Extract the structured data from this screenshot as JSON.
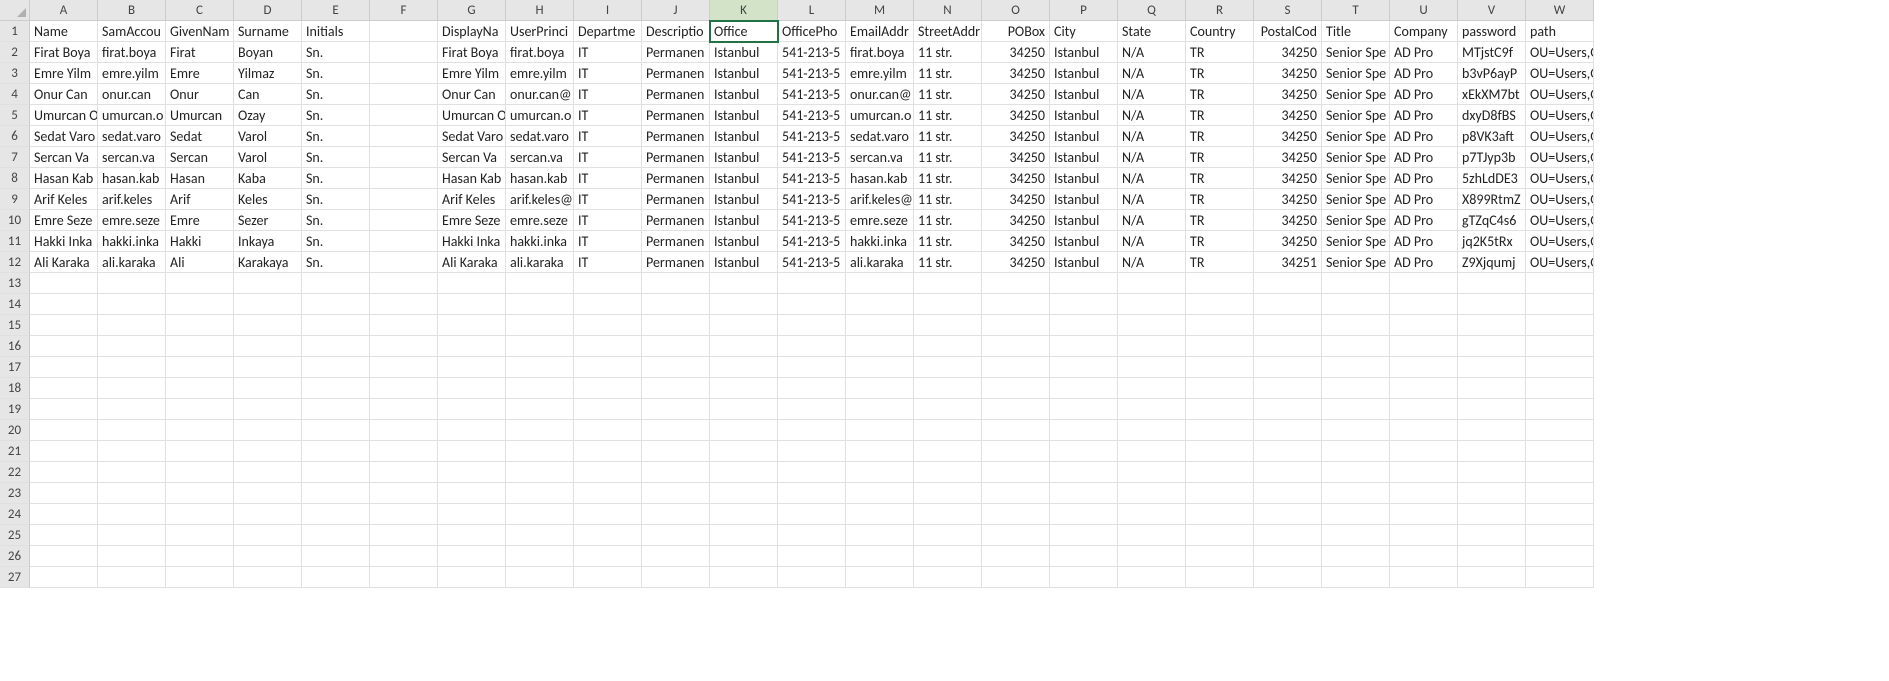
{
  "chart_data": {
    "type": "table",
    "columns": [
      "Name",
      "SamAccou",
      "GivenNam",
      "Surname",
      "Initials",
      "",
      "DisplayNa",
      "UserPrinci",
      "Departme",
      "Descriptio",
      "Office",
      "OfficePho",
      "EmailAddr",
      "StreetAddr",
      "POBox",
      "City",
      "State",
      "Country",
      "PostalCod",
      "Title",
      "Company",
      "password",
      "path"
    ],
    "rows": [
      [
        "Firat Boya",
        "firat.boya",
        "Firat",
        "Boyan",
        "Sn.",
        "",
        "Firat Boya",
        "firat.boya",
        "IT",
        "Permanen",
        "Istanbul",
        "541-213-5",
        "firat.boya",
        "11 str.",
        "34250",
        "Istanbul",
        "N/A",
        "TR",
        "34250",
        "Senior Spe",
        "AD Pro",
        "MTjstC9f",
        "OU=Users,OU=IT,OU=Is"
      ],
      [
        "Emre Yilm",
        "emre.yilm",
        "Emre",
        "Yilmaz",
        "Sn.",
        "",
        "Emre Yilm",
        "emre.yilm",
        "IT",
        "Permanen",
        "Istanbul",
        "541-213-5",
        "emre.yilm",
        "11 str.",
        "34250",
        "Istanbul",
        "N/A",
        "TR",
        "34250",
        "Senior Spe",
        "AD Pro",
        "b3vP6ayP",
        "OU=Users,OU=IT,OU=Is"
      ],
      [
        "Onur Can",
        "onur.can",
        "Onur",
        "Can",
        "Sn.",
        "",
        "Onur Can",
        "onur.can@",
        "IT",
        "Permanen",
        "Istanbul",
        "541-213-5",
        "onur.can@",
        "11 str.",
        "34250",
        "Istanbul",
        "N/A",
        "TR",
        "34250",
        "Senior Spe",
        "AD Pro",
        "xEkXM7bt",
        "OU=Users,OU=IT,OU=Is"
      ],
      [
        "Umurcan O",
        "umurcan.o",
        "Umurcan",
        "Ozay",
        "Sn.",
        "",
        "Umurcan O",
        "umurcan.o",
        "IT",
        "Permanen",
        "Istanbul",
        "541-213-5",
        "umurcan.o",
        "11 str.",
        "34250",
        "Istanbul",
        "N/A",
        "TR",
        "34250",
        "Senior Spe",
        "AD Pro",
        "dxyD8fBS",
        "OU=Users,OU=IT,OU=Is"
      ],
      [
        "Sedat Varo",
        "sedat.varo",
        "Sedat",
        "Varol",
        "Sn.",
        "",
        "Sedat Varo",
        "sedat.varo",
        "IT",
        "Permanen",
        "Istanbul",
        "541-213-5",
        "sedat.varo",
        "11 str.",
        "34250",
        "Istanbul",
        "N/A",
        "TR",
        "34250",
        "Senior Spe",
        "AD Pro",
        "p8VK3aft",
        "OU=Users,OU=IT,OU=Is"
      ],
      [
        "Sercan Va",
        "sercan.va",
        "Sercan",
        "Varol",
        "Sn.",
        "",
        "Sercan Va",
        "sercan.va",
        "IT",
        "Permanen",
        "Istanbul",
        "541-213-5",
        "sercan.va",
        "11 str.",
        "34250",
        "Istanbul",
        "N/A",
        "TR",
        "34250",
        "Senior Spe",
        "AD Pro",
        "p7TJyp3b",
        "OU=Users,OU=IT,OU=Is"
      ],
      [
        "Hasan Kab",
        "hasan.kab",
        "Hasan",
        "Kaba",
        "Sn.",
        "",
        "Hasan Kab",
        "hasan.kab",
        "IT",
        "Permanen",
        "Istanbul",
        "541-213-5",
        "hasan.kab",
        "11 str.",
        "34250",
        "Istanbul",
        "N/A",
        "TR",
        "34250",
        "Senior Spe",
        "AD Pro",
        "5zhLdDE3",
        "OU=Users,OU=IT,OU=Is"
      ],
      [
        "Arif Keles",
        "arif.keles",
        "Arif",
        "Keles",
        "Sn.",
        "",
        "Arif Keles",
        "arif.keles@",
        "IT",
        "Permanen",
        "Istanbul",
        "541-213-5",
        "arif.keles@",
        "11 str.",
        "34250",
        "Istanbul",
        "N/A",
        "TR",
        "34250",
        "Senior Spe",
        "AD Pro",
        "X899RtmZ",
        "OU=Users,OU=IT,OU=Is"
      ],
      [
        "Emre Seze",
        "emre.seze",
        "Emre",
        "Sezer",
        "Sn.",
        "",
        "Emre Seze",
        "emre.seze",
        "IT",
        "Permanen",
        "Istanbul",
        "541-213-5",
        "emre.seze",
        "11 str.",
        "34250",
        "Istanbul",
        "N/A",
        "TR",
        "34250",
        "Senior Spe",
        "AD Pro",
        "gTZqC4s6",
        "OU=Users,OU=IT,OU=Is"
      ],
      [
        "Hakki Inka",
        "hakki.inka",
        "Hakki",
        "Inkaya",
        "Sn.",
        "",
        "Hakki Inka",
        "hakki.inka",
        "IT",
        "Permanen",
        "Istanbul",
        "541-213-5",
        "hakki.inka",
        "11 str.",
        "34250",
        "Istanbul",
        "N/A",
        "TR",
        "34250",
        "Senior Spe",
        "AD Pro",
        "jq2K5tRx",
        "OU=Users,OU=IT,OU=Is"
      ],
      [
        "Ali Karaka",
        "ali.karaka",
        "Ali",
        "Karakaya",
        "Sn.",
        "",
        "Ali Karaka",
        "ali.karaka",
        "IT",
        "Permanen",
        "Istanbul",
        "541-213-5",
        "ali.karaka",
        "11 str.",
        "34250",
        "Istanbul",
        "N/A",
        "TR",
        "34251",
        "Senior Spe",
        "AD Pro",
        "Z9Xjqumj",
        "OU=Users,OU=IT,OU=Is"
      ]
    ]
  },
  "col_letters": [
    "A",
    "B",
    "C",
    "D",
    "E",
    "F",
    "G",
    "H",
    "I",
    "J",
    "K",
    "L",
    "M",
    "N",
    "O",
    "P",
    "Q",
    "R",
    "S",
    "T",
    "U",
    "V",
    "W"
  ],
  "numeric_cols": [
    14,
    18
  ],
  "selected": {
    "row": 0,
    "col": 10
  },
  "total_rows": 27
}
